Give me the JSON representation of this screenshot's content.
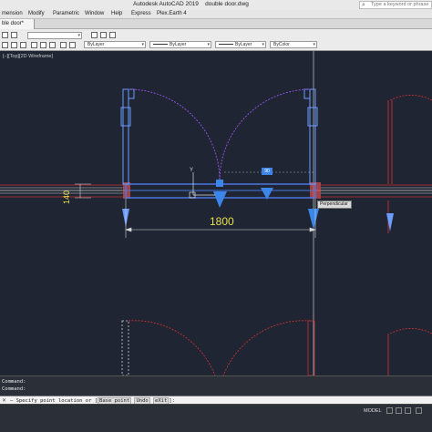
{
  "window": {
    "title": "Autodesk AutoCAD 2019    double door.dwg",
    "search_placeholder": "Type a keyword or phrase"
  },
  "menu": [
    "mension",
    "Modify",
    "Parametric",
    "Window",
    "Help",
    "Express",
    "Plex.Earth 4"
  ],
  "tabs": [
    {
      "label": "ble door*"
    }
  ],
  "toolbar": {
    "layer_combo": "",
    "color_combo": "ByLayer",
    "linetype_combo": "ByLayer",
    "lineweight_combo": "ByLayer",
    "plotstyle_combo": "ByColor"
  },
  "viewport": {
    "label": "[–][Top][2D Wireframe]",
    "tooltip": "Perpendicular",
    "dimension_horizontal": "1800",
    "dimension_vertical": "140",
    "grip_value": "90",
    "ucs_y": "Y",
    "ucs_x": "X"
  },
  "command": {
    "history": [
      "Command:",
      "Command:"
    ],
    "prompt_prefix": "– Specify point location or [",
    "options": [
      "Base point",
      "Undo",
      "eXit"
    ],
    "prompt_suffix": "]:"
  },
  "status": {
    "model_label": "MODEL"
  },
  "colors": {
    "background": "#1f2533",
    "wall": "#4a78e0",
    "door_swing": "#8a4fd8",
    "red_hidden": "#c83232",
    "dimension": "#e8e050",
    "grip": "#3b86e8"
  }
}
